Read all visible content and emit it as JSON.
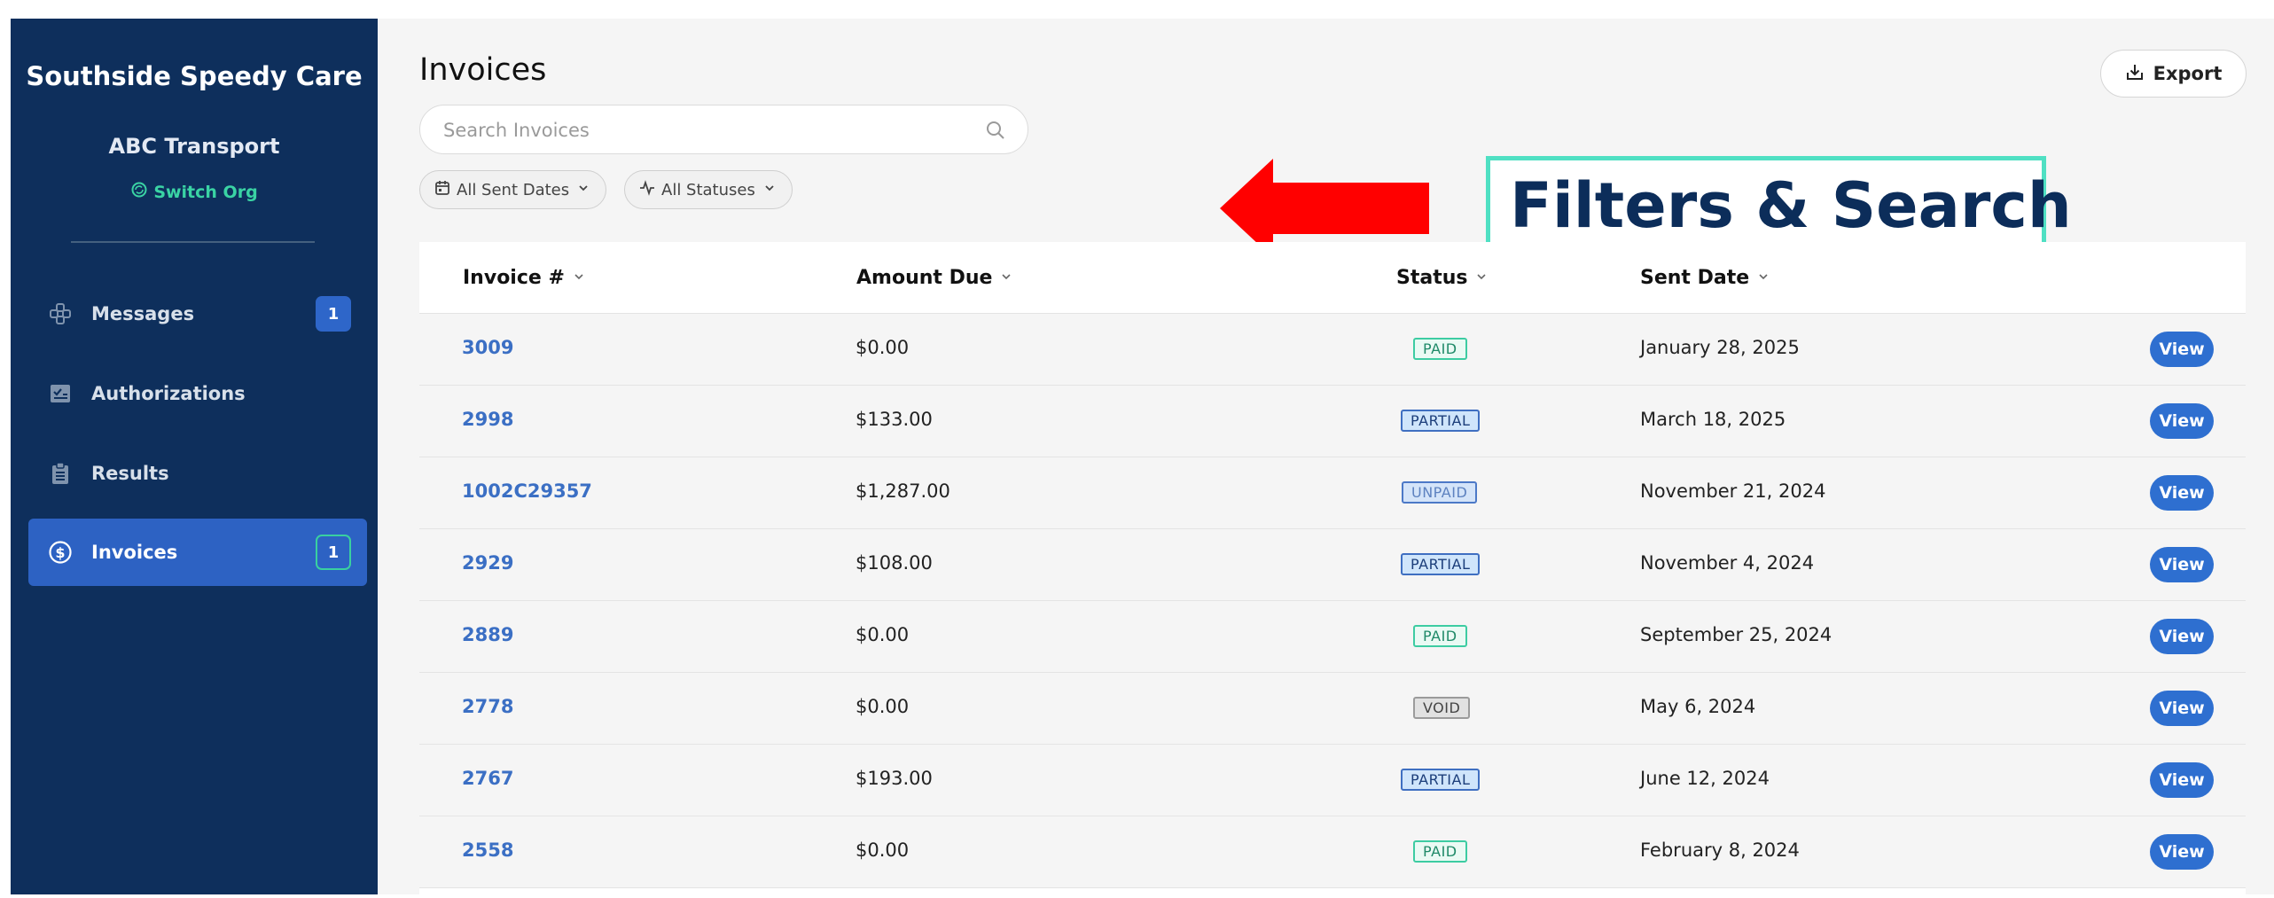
{
  "sidebar": {
    "org_name": "Southside Speedy Care",
    "org_sub": "ABC Transport",
    "switch_org": "Switch Org",
    "items": [
      {
        "label": "Messages",
        "icon": "messages-icon",
        "badge": "1"
      },
      {
        "label": "Authorizations",
        "icon": "authorizations-icon",
        "badge": ""
      },
      {
        "label": "Results",
        "icon": "clipboard-icon",
        "badge": ""
      },
      {
        "label": "Invoices",
        "icon": "dollar-circle-icon",
        "badge": "1",
        "active": true
      }
    ]
  },
  "header": {
    "title": "Invoices",
    "export_label": "Export"
  },
  "search": {
    "placeholder": "Search Invoices"
  },
  "filters": {
    "dates_label": "All Sent Dates",
    "status_label": "All Statuses"
  },
  "annotation": {
    "text": "Filters & Search"
  },
  "table": {
    "columns": [
      "Invoice #",
      "Amount Due",
      "Status",
      "Sent Date"
    ],
    "view_label": "View",
    "rows": [
      {
        "invoice": "3009",
        "amount": "$0.00",
        "status": "PAID",
        "date": "January 28, 2025"
      },
      {
        "invoice": "2998",
        "amount": "$133.00",
        "status": "PARTIAL",
        "date": "March 18, 2025"
      },
      {
        "invoice": "1002C29357",
        "amount": "$1,287.00",
        "status": "UNPAID",
        "date": "November 21, 2024"
      },
      {
        "invoice": "2929",
        "amount": "$108.00",
        "status": "PARTIAL",
        "date": "November 4, 2024"
      },
      {
        "invoice": "2889",
        "amount": "$0.00",
        "status": "PAID",
        "date": "September 25, 2024"
      },
      {
        "invoice": "2778",
        "amount": "$0.00",
        "status": "VOID",
        "date": "May 6, 2024"
      },
      {
        "invoice": "2767",
        "amount": "$193.00",
        "status": "PARTIAL",
        "date": "June 12, 2024"
      },
      {
        "invoice": "2558",
        "amount": "$0.00",
        "status": "PAID",
        "date": "February 8, 2024"
      }
    ]
  },
  "colors": {
    "sidebar_bg": "#0e2f5c",
    "active_nav": "#2d62c3",
    "accent_green": "#3ad3a4",
    "link_blue": "#3b6fc4",
    "annotation_arrow": "#ff0000"
  }
}
